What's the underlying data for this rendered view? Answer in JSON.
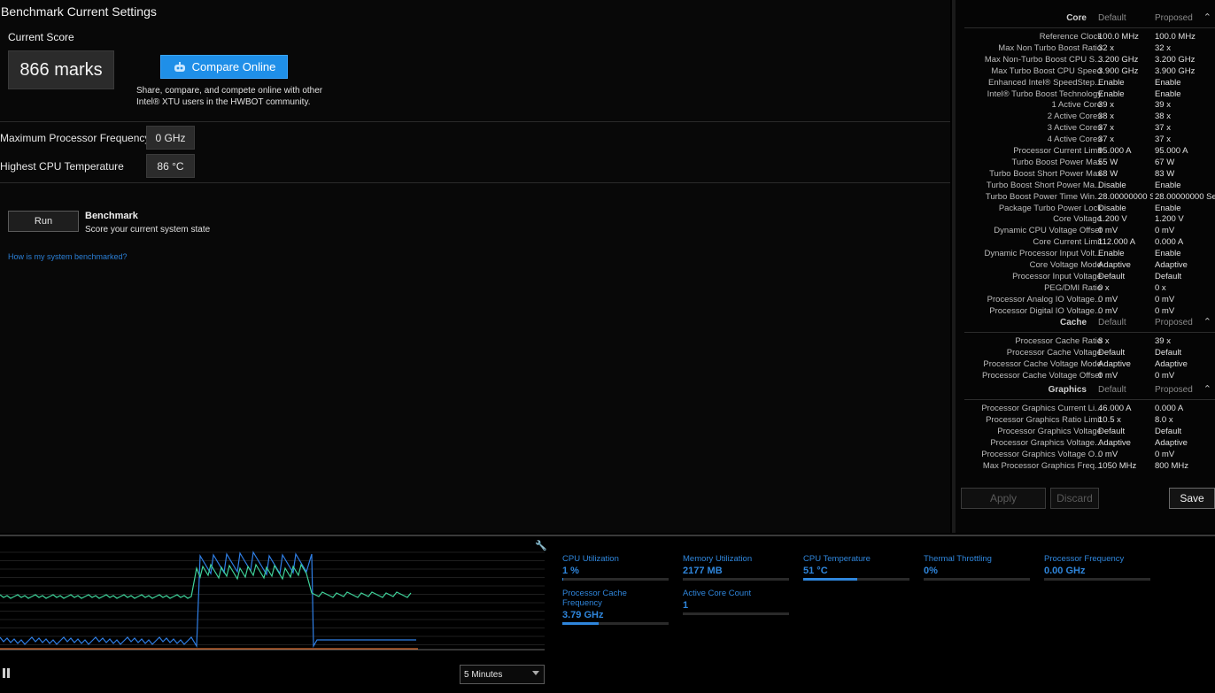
{
  "main": {
    "title": "Benchmark Current Settings",
    "current_score_label": "Current Score",
    "score_value": "866 marks",
    "compare_button": "Compare Online",
    "compare_description": "Share, compare, and compete online with other Intel® XTU users in the HWBOT community.",
    "metrics": [
      {
        "label": "Maximum Processor Frequency",
        "value": "0  GHz"
      },
      {
        "label": "Highest CPU Temperature",
        "value": "86 °C"
      }
    ],
    "run_button": "Run",
    "benchmark_title": "Benchmark",
    "benchmark_subtitle": "Score your current system state",
    "help_link": "How is my system benchmarked?"
  },
  "settings": {
    "groups": [
      {
        "name": "Core",
        "default_header": "Default",
        "proposed_header": "Proposed",
        "rows": [
          [
            "Reference Clock",
            "100.0 MHz",
            "100.0 MHz"
          ],
          [
            "Max Non Turbo Boost Ratio",
            "32 x",
            "32 x"
          ],
          [
            "Max Non-Turbo Boost CPU S...",
            "3.200 GHz",
            "3.200 GHz"
          ],
          [
            "Max Turbo Boost CPU Speed",
            "3.900 GHz",
            "3.900 GHz"
          ],
          [
            "Enhanced Intel® SpeedStep...",
            "Enable",
            "Enable"
          ],
          [
            "Intel® Turbo Boost Technology",
            "Enable",
            "Enable"
          ],
          [
            "1 Active Core",
            "39 x",
            "39 x"
          ],
          [
            "2 Active Cores",
            "38 x",
            "38 x"
          ],
          [
            "3 Active Cores",
            "37 x",
            "37 x"
          ],
          [
            "4 Active Cores",
            "37 x",
            "37 x"
          ],
          [
            "Processor Current Limit",
            "95.000 A",
            "95.000 A"
          ],
          [
            "Turbo Boost Power Max",
            "55 W",
            "67 W"
          ],
          [
            "Turbo Boost Short Power Max",
            "68 W",
            "83 W"
          ],
          [
            "Turbo Boost Short Power Ma...",
            "Disable",
            "Enable"
          ],
          [
            "Turbo Boost Power Time Win...",
            "28.00000000 Se",
            "28.00000000 Se"
          ],
          [
            "Package Turbo Power Lock",
            "Disable",
            "Enable"
          ],
          [
            "Core Voltage",
            "1.200 V",
            "1.200 V"
          ],
          [
            "Dynamic CPU Voltage Offset",
            "0 mV",
            "0 mV"
          ],
          [
            "Core Current Limit",
            "112.000 A",
            "0.000 A"
          ],
          [
            "Dynamic Processor Input Volt...",
            "Enable",
            "Enable"
          ],
          [
            "Core Voltage Mode",
            "Adaptive",
            "Adaptive"
          ],
          [
            "Processor Input Voltage",
            "Default",
            "Default"
          ],
          [
            "PEG/DMI Ratio",
            "0 x",
            "0 x"
          ],
          [
            "Processor Analog IO Voltage...",
            "0 mV",
            "0 mV"
          ],
          [
            "Processor Digital IO Voltage...",
            "0 mV",
            "0 mV"
          ]
        ]
      },
      {
        "name": "Cache",
        "default_header": "Default",
        "proposed_header": "Proposed",
        "rows": [
          [
            "Processor Cache Ratio",
            "8 x",
            "39 x"
          ],
          [
            "Processor Cache Voltage",
            "Default",
            "Default"
          ],
          [
            "Processor Cache Voltage Mode",
            "Adaptive",
            "Adaptive"
          ],
          [
            "Processor Cache Voltage Offset",
            "0 mV",
            "0 mV"
          ]
        ]
      },
      {
        "name": "Graphics",
        "default_header": "Default",
        "proposed_header": "Proposed",
        "rows": [
          [
            "Processor Graphics Current Li...",
            "46.000 A",
            "0.000 A"
          ],
          [
            "Processor Graphics Ratio Limit",
            "10.5 x",
            "8.0 x"
          ],
          [
            "Processor Graphics Voltage",
            "Default",
            "Default"
          ],
          [
            "Processor Graphics Voltage...",
            "Adaptive",
            "Adaptive"
          ],
          [
            "Processor Graphics Voltage O...",
            "0 mV",
            "0 mV"
          ],
          [
            "Max Processor Graphics Freq...",
            "1050 MHz",
            "800 MHz"
          ]
        ]
      }
    ],
    "apply_button": "Apply",
    "discard_button": "Discard",
    "save_button": "Save"
  },
  "monitor": {
    "stats": [
      {
        "title": "CPU Utilization",
        "value": "1 %",
        "level": 0.01
      },
      {
        "title": "Memory Utilization",
        "value": "2177  MB",
        "level": 0.0
      },
      {
        "title": "CPU Temperature",
        "value": "51 °C",
        "level": 0.51
      },
      {
        "title": "Thermal Throttling",
        "value": "0%",
        "level": 0.0
      },
      {
        "title": "Processor Frequency",
        "value": "0.00 GHz",
        "level": 0.0
      },
      {
        "title": "Processor Cache Frequency",
        "value": "3.79 GHz",
        "level": 0.34
      },
      {
        "title": "Active Core Count",
        "value": "1",
        "level": 0.0
      }
    ],
    "time_range": "5 Minutes"
  },
  "colors": {
    "accent": "#1f8fe8",
    "graph_green": "#3fd39a",
    "graph_blue": "#2f7fe6",
    "graph_orange": "#d2662a"
  }
}
